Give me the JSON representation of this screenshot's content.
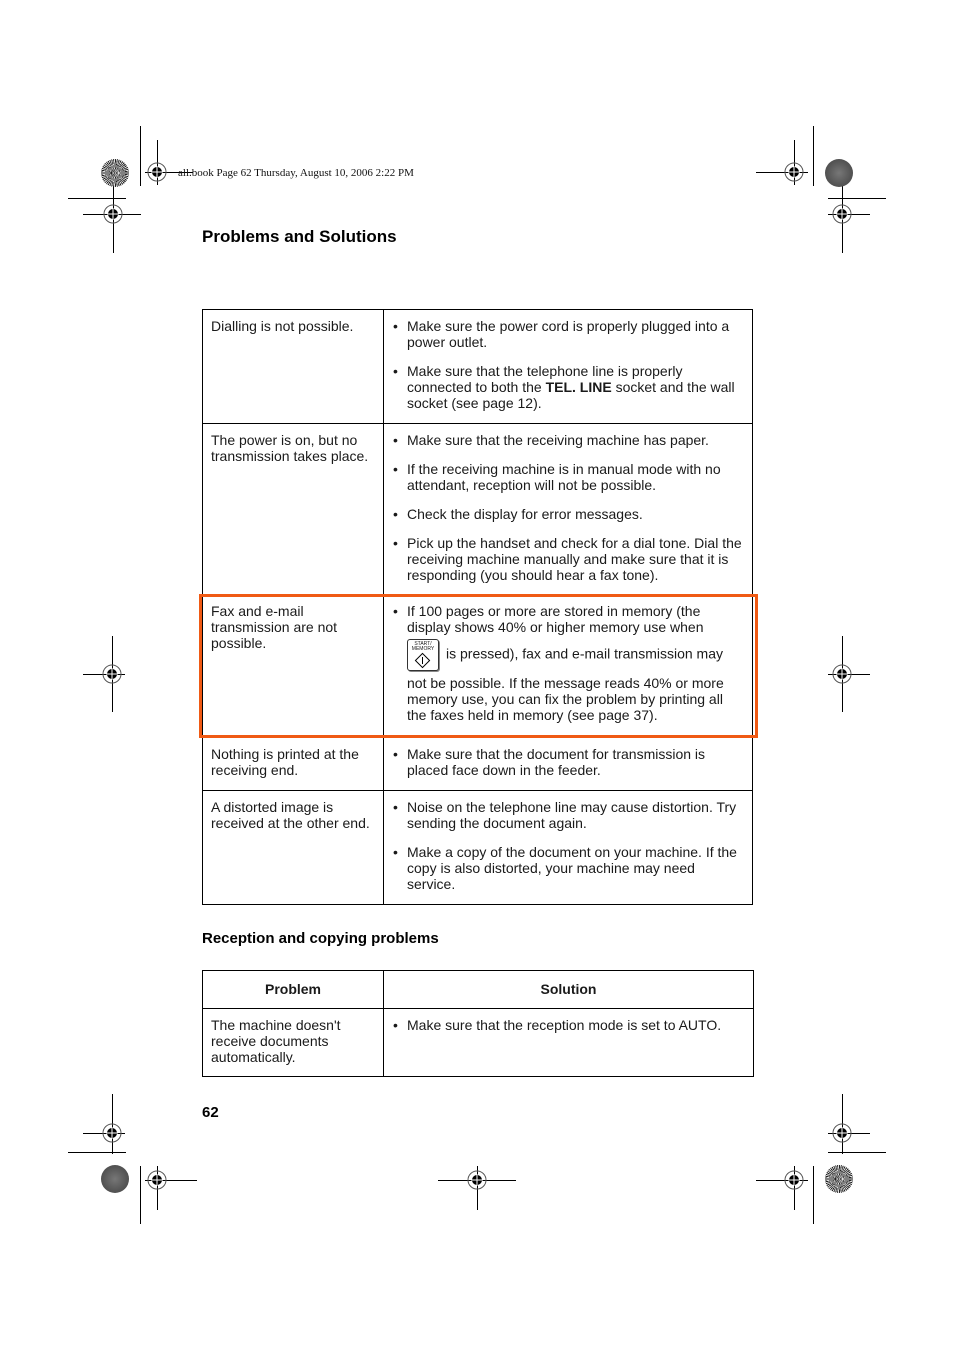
{
  "header": {
    "stamp": "all.book  Page 62  Thursday, August 10, 2006  2:22 PM"
  },
  "page": {
    "section_title": "Problems and Solutions",
    "page_number": "62"
  },
  "transmission_table": {
    "rows": [
      {
        "problem": "Dialling is not possible.",
        "solutions": [
          {
            "text": "Make sure the power cord is properly plugged into a power outlet."
          },
          {
            "pre": "Make sure that the telephone line is properly connected to both the ",
            "bold": "TEL. LINE",
            "post": " socket and the wall socket (see page 12)."
          }
        ]
      },
      {
        "problem": "The power is on, but no transmission takes place.",
        "solutions": [
          {
            "text": "Make sure that the receiving machine has paper."
          },
          {
            "text": "If the receiving machine is in manual mode with no attendant, reception will not be possible."
          },
          {
            "text": "Check the display for error messages."
          },
          {
            "text": "Pick up the handset and check for a dial tone. Dial the receiving machine manually and make sure that it is responding (you should hear a fax tone)."
          }
        ]
      },
      {
        "problem": "Fax and e-mail transmission are not possible.",
        "highlighted": true,
        "solutions": [
          {
            "pre": " If 100 pages or more are stored in memory (the display shows 40% or higher memory use when",
            "icon": "start-memory-key-icon",
            "icon_label": "START/ MEMORY",
            "post": "is pressed), fax and e-mail transmission may not be possible.  If the message reads 40% or more memory use, you can fix the problem by printing all the faxes held in memory (see page 37)."
          }
        ]
      },
      {
        "problem": "Nothing is printed at the receiving end.",
        "solutions": [
          {
            "text": "Make sure that the document for transmission is placed face down in the feeder."
          }
        ]
      },
      {
        "problem": "A distorted image is received at the other end.",
        "solutions": [
          {
            "text": "Noise on the telephone line may cause distortion. Try sending the document again."
          },
          {
            "text": "Make a copy of the document on your machine. If the copy is also distorted, your machine may need service."
          }
        ]
      }
    ]
  },
  "reception_section": {
    "title": "Reception and copying problems",
    "headers": {
      "problem": "Problem",
      "solution": "Solution"
    },
    "rows": [
      {
        "problem": "The machine doesn't receive documents automatically.",
        "solutions": [
          {
            "text": "Make sure that the reception mode is set to AUTO."
          }
        ]
      }
    ]
  },
  "colors": {
    "highlight_border": "#f05a14",
    "text": "#1a1a1a"
  }
}
